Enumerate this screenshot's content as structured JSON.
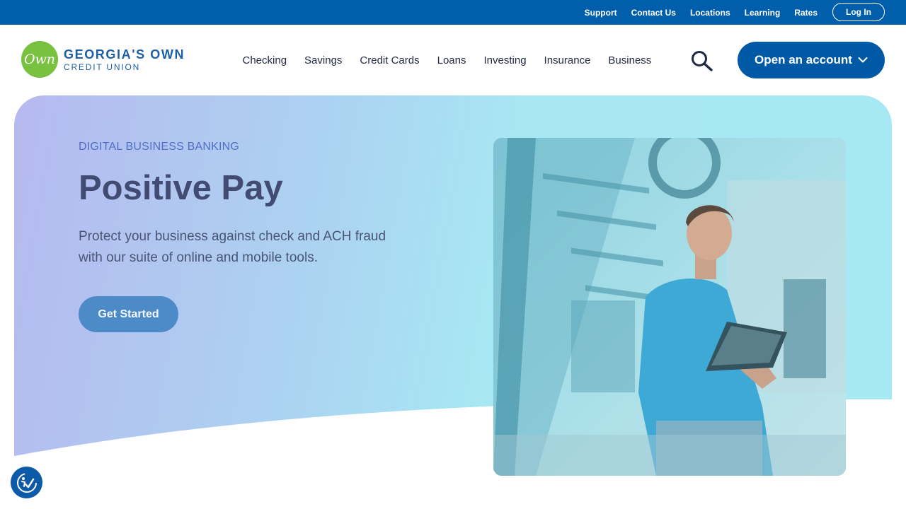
{
  "utility_nav": {
    "links": [
      "Support",
      "Contact Us",
      "Locations",
      "Learning",
      "Rates"
    ],
    "login_label": "Log In"
  },
  "brand": {
    "logo_mark": "Own",
    "name_line1": "GEORGIA'S OWN",
    "name_line2": "CREDIT UNION"
  },
  "main_nav": {
    "items": [
      "Checking",
      "Savings",
      "Credit Cards",
      "Loans",
      "Investing",
      "Insurance",
      "Business"
    ],
    "search_icon": "search-icon",
    "cta_label": "Open an account"
  },
  "hero": {
    "eyebrow": "DIGITAL BUSINESS BANKING",
    "title": "Positive Pay",
    "description": "Protect your business against check and ACH fraud with our suite of online and mobile tools.",
    "button_label": "Get Started"
  },
  "colors": {
    "utility_bar": "#005eaa",
    "brand_green": "#79c141",
    "brand_blue": "#1d5fa6",
    "cta_blue": "#0059a5",
    "hero_title": "#424c73",
    "button": "#4d8ac8"
  },
  "accessibility_widget": {
    "icon": "accessibility-icon"
  }
}
